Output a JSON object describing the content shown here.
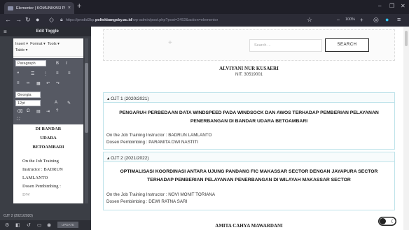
{
  "browser": {
    "tab_title": "Elementor | KOMUNIKASI PENE",
    "url_prefix": "https://prodid3kp.",
    "url_domain": "poltekbangsby.ac.id",
    "url_path": "/wp-admin/post.php?post=2452&action=elementor",
    "zoom": "100%",
    "new_tab": "+",
    "min": "–",
    "max": "❐",
    "close": "✕"
  },
  "panel": {
    "title": "Edit Toggle",
    "menu": [
      "Insert ▾",
      "Format ▾",
      "Tools ▾",
      "Table ▾"
    ],
    "paragraph_select": "Paragraph",
    "font_select": "Georgia",
    "size_select": "12pt",
    "content_lines": [
      "DI BANDAR",
      "UDARA",
      "BETOAMBARI"
    ],
    "body_lines": [
      "On the Job Training",
      "Instructor : BADRUN",
      "LAMLANTO",
      "Dosen Pembimbing :",
      "DW"
    ],
    "accordion_label": "OJT 2 (2021/2020)",
    "update_label": "UPDATE"
  },
  "page": {
    "search_placeholder": "Search ...",
    "search_button": "SEARCH",
    "student1_name": "ALVIYANI NUR KUSAERI",
    "student1_nit": "NIT. 30519001",
    "ojt1_label": "▴ OJT 1 (2020/2021)",
    "ojt1_title": "PENGARUH PERBEDAAN DATA WINDSPEED PADA WINDSOCK DAN AWOS TERHADAP PEMBERIAN PELAYANAN PENERBANGAN DI BANDAR UDARA BETOAMBARI",
    "ojt1_instructor": "On the Job Training Instructor : BADRUN LAMLANTO",
    "ojt1_supervisor": "Dosen Pembimbing : PARAMITA DWI NASTITI",
    "ojt2_label": "▴ OJT 2 (2021/2022)",
    "ojt2_title": "OPTIMALISASI KOORDINASI ANTARA UJUNG PANDANG FIC MAKASSAR SECTOR DENGAN JAYAPURA SECTOR TERHADAP PEMBERIAN PELAYANAN PENERBANGAN DI WILAYAH MAKASSAR SECTOR",
    "ojt2_instructor": "On the Job Training Instructor : NOVI MONIT TORIANA",
    "ojt2_supervisor": "Dosen Pembimbing : DEWI RATNA SARI",
    "student2_name": "AMITA CAHYA MAWARDANI"
  }
}
